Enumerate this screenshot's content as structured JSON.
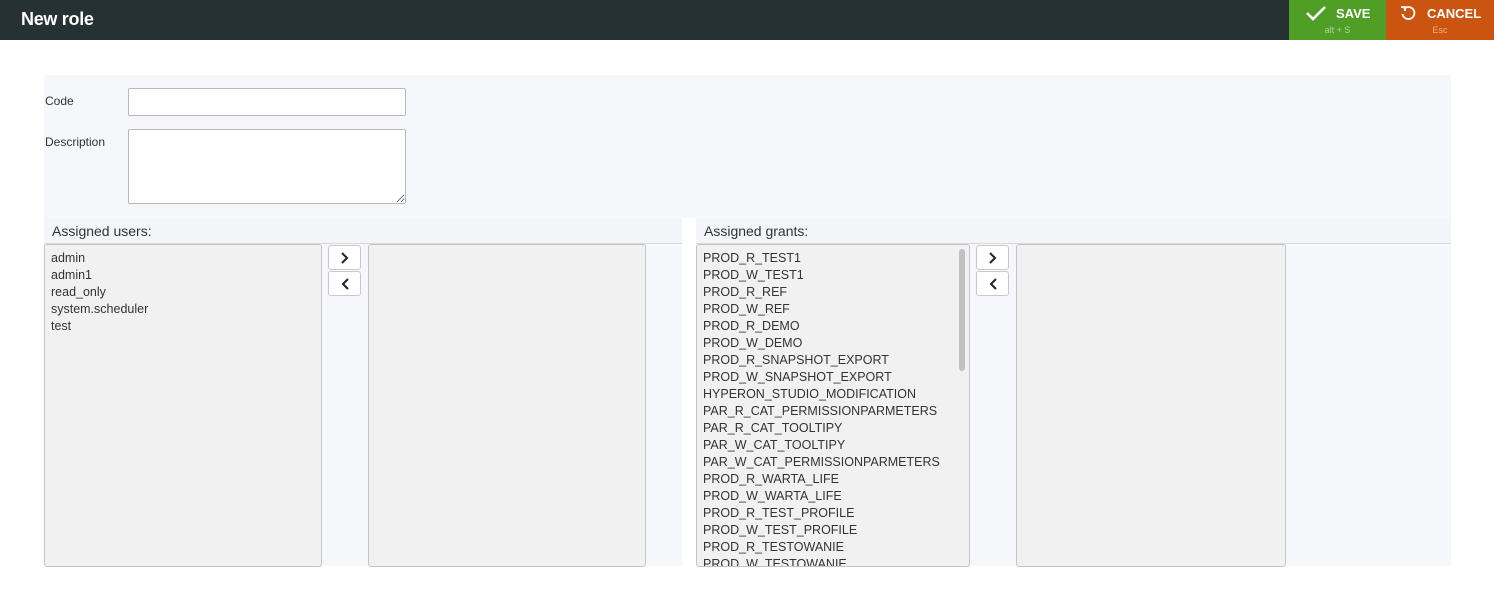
{
  "header": {
    "title": "New role",
    "save": {
      "label": "SAVE",
      "shortcut": "alt + S",
      "color": "#4f9e26"
    },
    "cancel": {
      "label": "CANCEL",
      "shortcut": "Esc",
      "color": "#cb5410"
    },
    "bar_color": "#263133"
  },
  "form": {
    "code_label": "Code",
    "code_value": "",
    "description_label": "Description",
    "description_value": ""
  },
  "users": {
    "heading": "Assigned users:",
    "available": [
      "admin",
      "admin1",
      "read_only",
      "system.scheduler",
      "test"
    ],
    "assigned": []
  },
  "grants": {
    "heading": "Assigned grants:",
    "available": [
      "PROD_R_TEST1",
      "PROD_W_TEST1",
      "PROD_R_REF",
      "PROD_W_REF",
      "PROD_R_DEMO",
      "PROD_W_DEMO",
      "PROD_R_SNAPSHOT_EXPORT",
      "PROD_W_SNAPSHOT_EXPORT",
      "HYPERON_STUDIO_MODIFICATION",
      "PAR_R_CAT_PERMISSIONPARMETERS",
      "PAR_R_CAT_TOOLTIPY",
      "PAR_W_CAT_TOOLTIPY",
      "PAR_W_CAT_PERMISSIONPARMETERS",
      "PROD_R_WARTA_LIFE",
      "PROD_W_WARTA_LIFE",
      "PROD_R_TEST_PROFILE",
      "PROD_W_TEST_PROFILE",
      "PROD_R_TESTOWANIE",
      "PROD_W_TESTOWANIE"
    ],
    "assigned": []
  },
  "icons": {
    "save": "check-icon",
    "cancel": "undo-icon",
    "move_right": "chevron-right-icon",
    "move_left": "chevron-left-icon"
  }
}
